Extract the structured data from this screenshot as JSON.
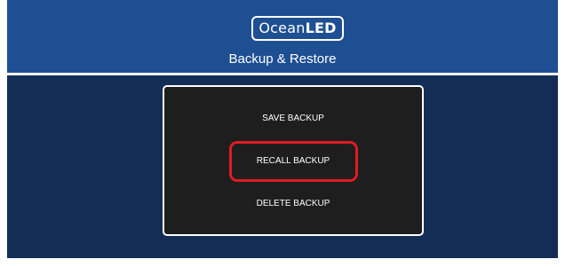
{
  "header": {
    "logo": {
      "text_light": "Ocean",
      "text_bold": "LED"
    },
    "title": "Backup & Restore"
  },
  "menu": {
    "save_label": "SAVE BACKUP",
    "recall_label": "RECALL BACKUP",
    "delete_label": "DELETE BACKUP"
  },
  "colors": {
    "header_bg": "#1e4f93",
    "main_bg": "#132d55",
    "panel_bg": "#1e1e1e",
    "highlight": "#e01b22"
  }
}
